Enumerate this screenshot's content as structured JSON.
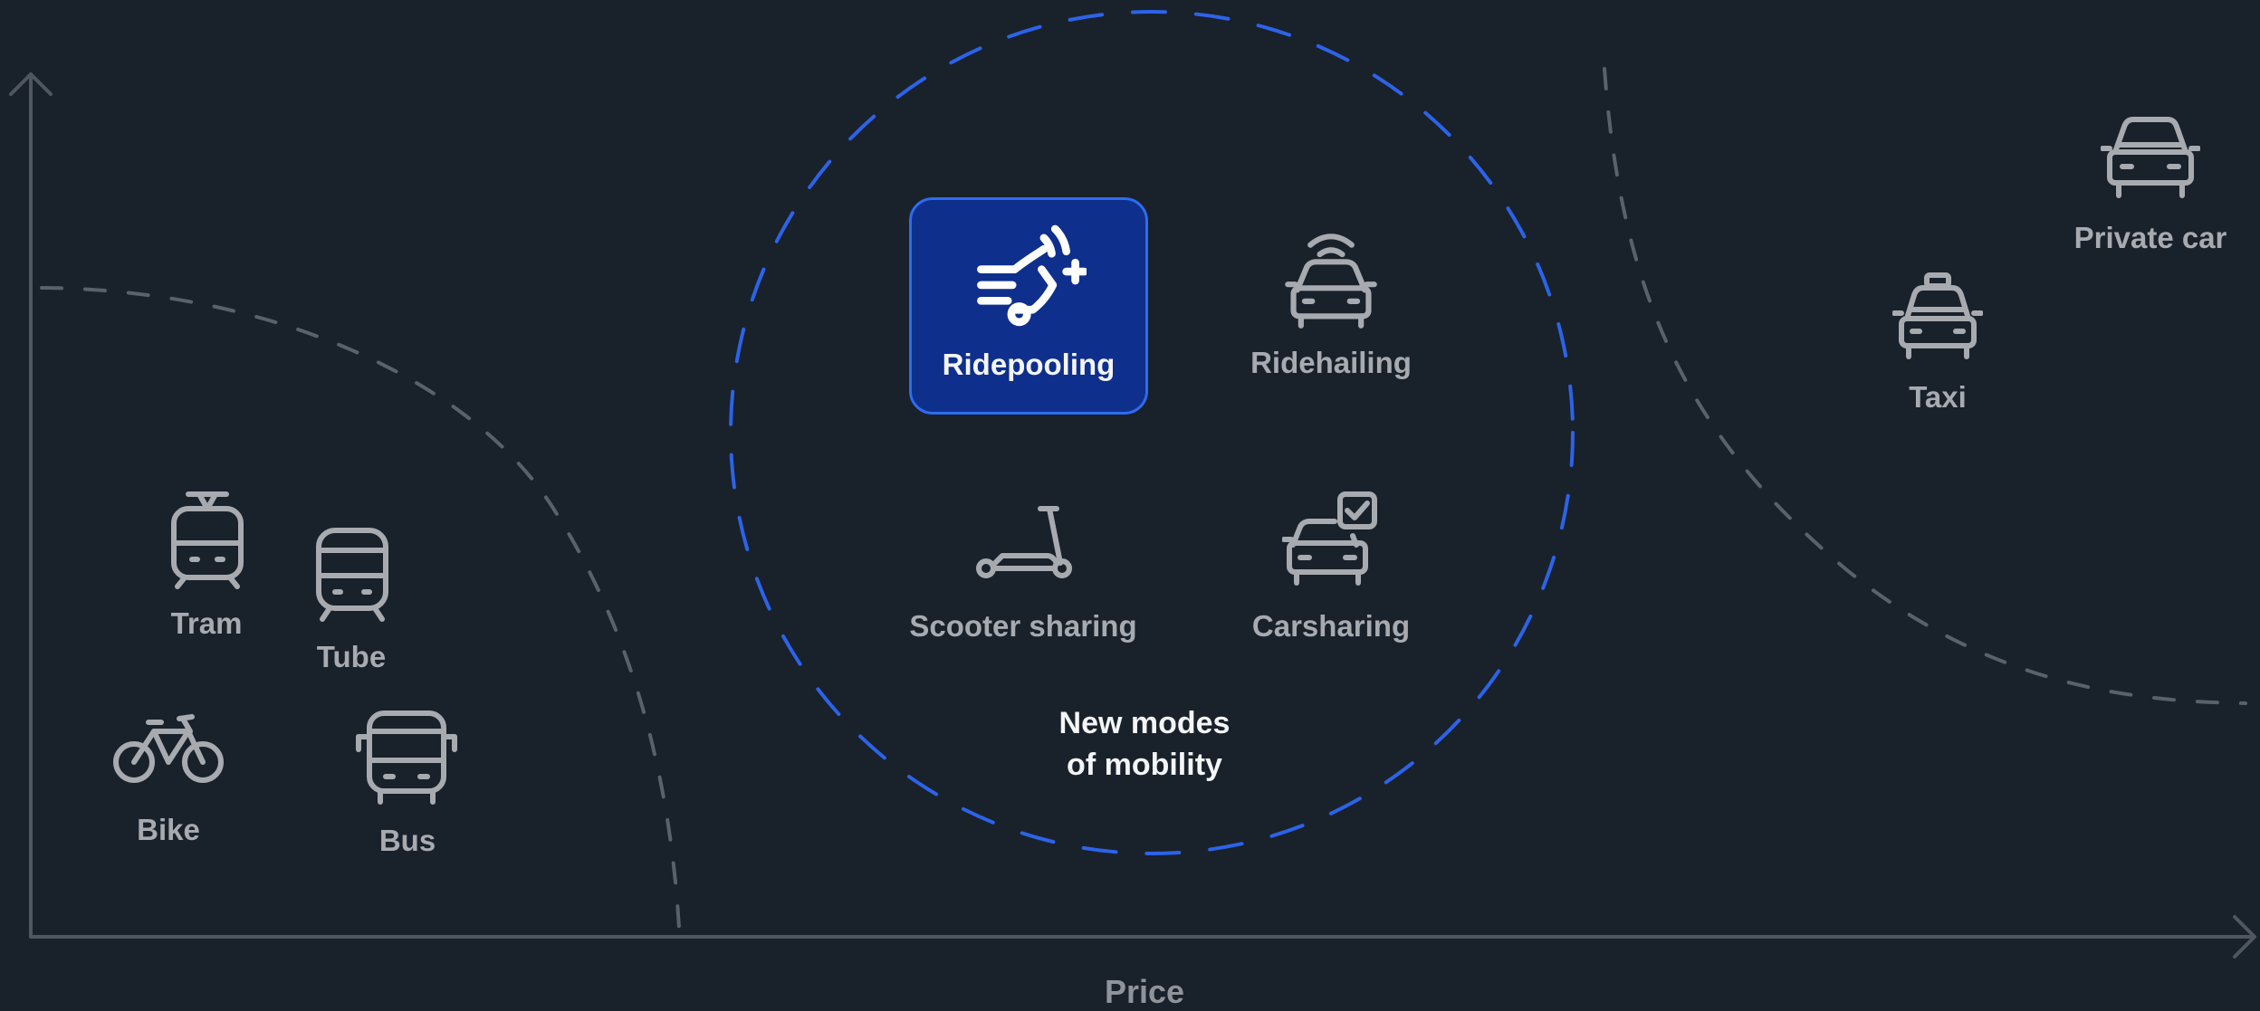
{
  "axis": {
    "x_label": "Price"
  },
  "zones": {
    "new_modes_caption_line1": "New modes",
    "new_modes_caption_line2": "of mobility"
  },
  "modes": {
    "ridepooling": {
      "label": "Ridepooling",
      "icon": "ridepooling-icon",
      "highlighted": true
    },
    "ridehailing": {
      "label": "Ridehailing",
      "icon": "ridehailing-car-icon"
    },
    "scooter_sharing": {
      "label": "Scooter sharing",
      "icon": "scooter-icon"
    },
    "carsharing": {
      "label": "Carsharing",
      "icon": "carsharing-car-icon"
    },
    "tram": {
      "label": "Tram",
      "icon": "tram-icon"
    },
    "tube": {
      "label": "Tube",
      "icon": "tube-icon"
    },
    "bike": {
      "label": "Bike",
      "icon": "bike-icon"
    },
    "bus": {
      "label": "Bus",
      "icon": "bus-icon"
    },
    "taxi": {
      "label": "Taxi",
      "icon": "taxi-icon"
    },
    "private_car": {
      "label": "Private car",
      "icon": "private-car-icon"
    }
  },
  "colors": {
    "background": "#19212b",
    "icon_gray": "#a7abb0",
    "dashed_gray": "#5a6169",
    "circle_blue": "#2c63e8",
    "highlight_fill": "#0e2f8b",
    "highlight_border": "#2e6cf0",
    "axis": "#4f565e"
  }
}
